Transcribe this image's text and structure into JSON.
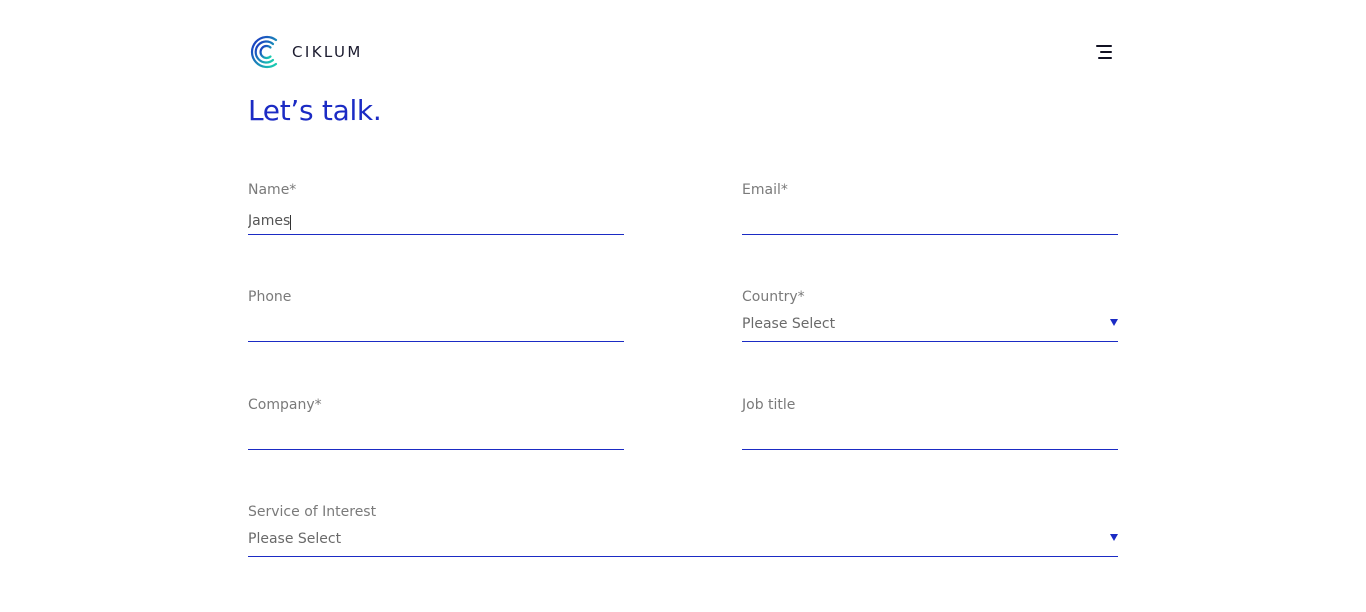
{
  "brand": {
    "name": "CIKLUM",
    "accent_color": "#1b2bc4",
    "logo_gradient": [
      "#1b2bc4",
      "#19d3b0"
    ]
  },
  "header": {
    "menu_icon": "hamburger-menu-icon"
  },
  "page": {
    "heading": "Let’s talk."
  },
  "form": {
    "name": {
      "label": "Name*",
      "value": "James"
    },
    "email": {
      "label": "Email*",
      "value": ""
    },
    "phone": {
      "label": "Phone",
      "value": ""
    },
    "country": {
      "label": "Country*",
      "selected": "Please Select"
    },
    "company": {
      "label": "Company*",
      "value": ""
    },
    "job_title": {
      "label": "Job title",
      "value": ""
    },
    "service": {
      "label": "Service of Interest",
      "selected": "Please Select"
    }
  }
}
